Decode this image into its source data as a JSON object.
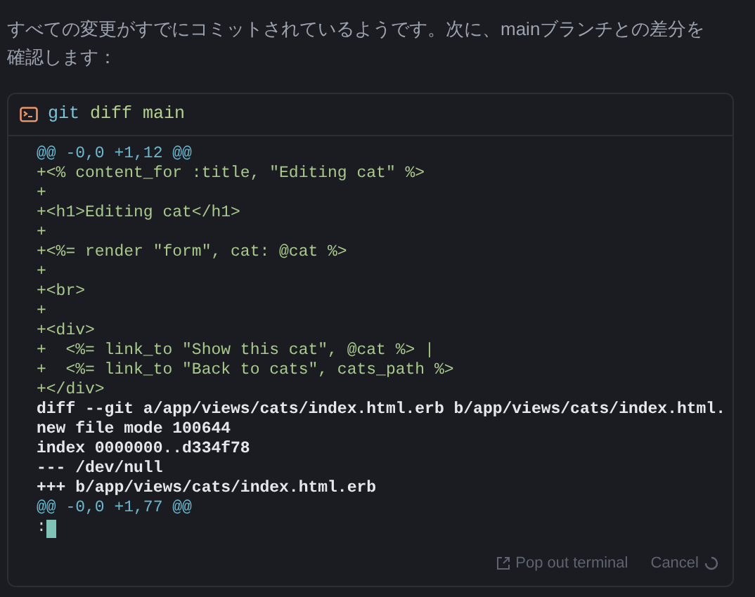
{
  "message": "すべての変更がすでにコミットされているようです。次に、mainブランチとの差分を確認します：",
  "terminal": {
    "command_name": "git",
    "command_args": "diff main",
    "lines": [
      {
        "kind": "hunk",
        "text": "@@ -0,0 +1,12 @@"
      },
      {
        "kind": "add",
        "text": "+<% content_for :title, \"Editing cat\" %>"
      },
      {
        "kind": "add",
        "text": "+"
      },
      {
        "kind": "add",
        "text": "+<h1>Editing cat</h1>"
      },
      {
        "kind": "add",
        "text": "+"
      },
      {
        "kind": "add",
        "text": "+<%= render \"form\", cat: @cat %>"
      },
      {
        "kind": "add",
        "text": "+"
      },
      {
        "kind": "add",
        "text": "+<br>"
      },
      {
        "kind": "add",
        "text": "+"
      },
      {
        "kind": "add",
        "text": "+<div>"
      },
      {
        "kind": "add",
        "text": "+  <%= link_to \"Show this cat\", @cat %> |"
      },
      {
        "kind": "add",
        "text": "+  <%= link_to \"Back to cats\", cats_path %>"
      },
      {
        "kind": "add",
        "text": "+</div>"
      },
      {
        "kind": "meta",
        "text": "diff --git a/app/views/cats/index.html.erb b/app/views/cats/index.html."
      },
      {
        "kind": "meta",
        "text": "new file mode 100644"
      },
      {
        "kind": "meta",
        "text": "index 0000000..d334f78"
      },
      {
        "kind": "meta",
        "text": "--- /dev/null"
      },
      {
        "kind": "meta",
        "text": "+++ b/app/views/cats/index.html.erb"
      },
      {
        "kind": "hunk",
        "text": "@@ -0,0 +1,77 @@"
      },
      {
        "kind": "prompt",
        "text": ":"
      }
    ],
    "pop_out": "Pop out terminal",
    "cancel": "Cancel"
  }
}
